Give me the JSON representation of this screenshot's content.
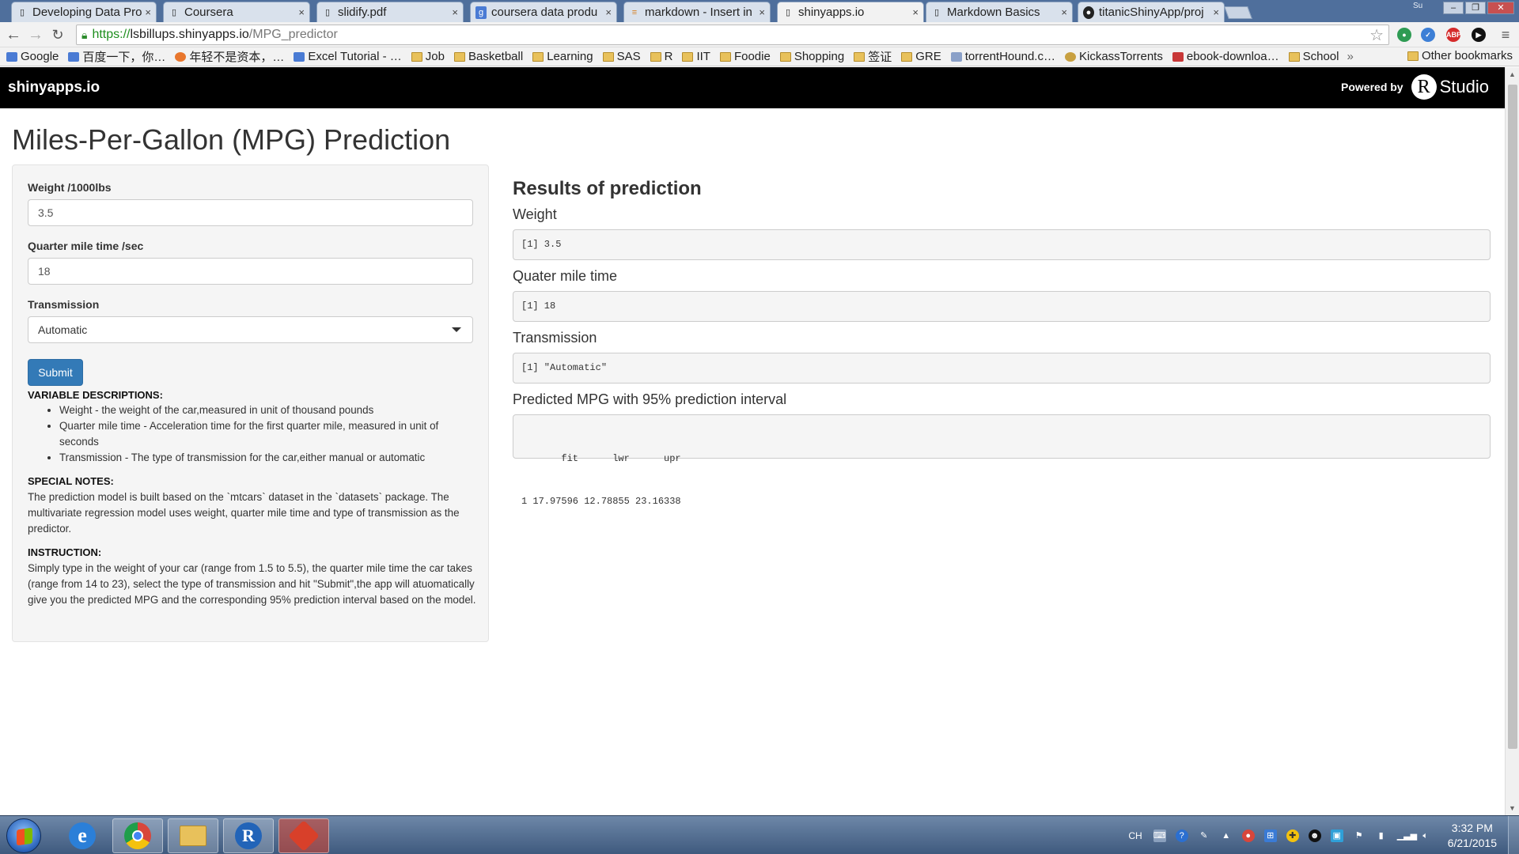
{
  "browser": {
    "tabs": [
      {
        "title": "Developing Data Pro",
        "icon": "doc-icon",
        "active": false
      },
      {
        "title": "Coursera",
        "icon": "doc-icon",
        "active": false
      },
      {
        "title": "slidify.pdf",
        "icon": "doc-icon",
        "active": false
      },
      {
        "title": "coursera data produ",
        "icon": "google-icon",
        "active": false
      },
      {
        "title": "markdown - Insert in",
        "icon": "stackoverflow-icon",
        "active": false
      },
      {
        "title": "shinyapps.io",
        "icon": "doc-icon",
        "active": true
      },
      {
        "title": "Markdown Basics",
        "icon": "doc-icon",
        "active": false
      },
      {
        "title": "titanicShinyApp/proj",
        "icon": "github-icon",
        "active": false
      }
    ],
    "window_user": "Su",
    "url": {
      "scheme": "https://",
      "host": "lsbillups.shinyapps.io",
      "path": "/MPG_predictor"
    },
    "bookmarks": [
      {
        "label": "Google",
        "type": "site"
      },
      {
        "label": "百度一下，你…",
        "type": "site"
      },
      {
        "label": "年轻不是资本，…",
        "type": "site"
      },
      {
        "label": "Excel Tutorial - …",
        "type": "site"
      },
      {
        "label": "Job",
        "type": "folder"
      },
      {
        "label": "Basketball",
        "type": "folder"
      },
      {
        "label": "Learning",
        "type": "folder"
      },
      {
        "label": "SAS",
        "type": "folder"
      },
      {
        "label": "R",
        "type": "folder"
      },
      {
        "label": "IIT",
        "type": "folder"
      },
      {
        "label": "Foodie",
        "type": "folder"
      },
      {
        "label": "Shopping",
        "type": "folder"
      },
      {
        "label": "签证",
        "type": "folder"
      },
      {
        "label": "GRE",
        "type": "folder"
      },
      {
        "label": "torrentHound.c…",
        "type": "site"
      },
      {
        "label": "KickassTorrents",
        "type": "site"
      },
      {
        "label": "ebook-downloa…",
        "type": "site"
      },
      {
        "label": "School",
        "type": "folder"
      }
    ],
    "bookmarks_overflow": "»",
    "other_bookmarks": "Other bookmarks"
  },
  "shiny": {
    "brand": "shinyapps.io",
    "powered_by": "Powered by",
    "rstudio_r": "R",
    "rstudio_studio": "Studio"
  },
  "app": {
    "title": "Miles-Per-Gallon (MPG) Prediction",
    "inputs": {
      "weight_label": "Weight /1000lbs",
      "weight_value": "3.5",
      "qsec_label": "Quarter mile time /sec",
      "qsec_value": "18",
      "trans_label": "Transmission",
      "trans_value": "Automatic",
      "submit_label": "Submit"
    },
    "var_desc_heading": "VARIABLE DESCRIPTIONS:",
    "var_desc": [
      "Weight - the weight of the car,measured in unit of thousand pounds",
      "Quarter mile time - Acceleration time for the first quarter mile, measured in unit of seconds",
      "Transmission - The type of transmission for the car,either manual or automatic"
    ],
    "notes_heading": "SPECIAL NOTES:",
    "notes_text": "The prediction model is built based on the `mtcars` dataset in the `datasets` package. The multivariate regression model uses weight, quarter mile time and type of transmission as the predictor.",
    "instruction_heading": "INSTRUCTION:",
    "instruction_text": "Simply type in the weight of your car (range from 1.5 to 5.5), the quarter mile time the car takes (range from 14 to 23), select the type of transmission and hit \"Submit\",the app will atuomatically give you the predicted MPG and the corresponding 95% prediction interval based on the model.",
    "results": {
      "title": "Results of prediction",
      "weight_label": "Weight",
      "weight_out": "[1] 3.5",
      "qsec_label": "Quater mile time",
      "qsec_out": "[1] 18",
      "trans_label": "Transmission",
      "trans_out": "[1] \"Automatic\"",
      "mpg_label": "Predicted MPG with 95% prediction interval",
      "mpg_out_header": "       fit      lwr      upr",
      "mpg_out_row": "1 17.97596 12.78855 23.16338"
    }
  },
  "taskbar": {
    "apps": [
      {
        "name": "internet-explorer",
        "glyph": "e",
        "color": "#2b7fd8",
        "open": false
      },
      {
        "name": "chrome",
        "glyph": "",
        "color": "#d8463b",
        "open": true
      },
      {
        "name": "file-explorer",
        "glyph": "",
        "color": "#e8c15b",
        "open": true
      },
      {
        "name": "r-gui",
        "glyph": "R",
        "color": "#2264b8",
        "open": true
      },
      {
        "name": "git",
        "glyph": "◆",
        "color": "#d8402a",
        "open": true
      }
    ],
    "lang": "CH",
    "time": "3:32 PM",
    "date": "6/21/2015"
  }
}
